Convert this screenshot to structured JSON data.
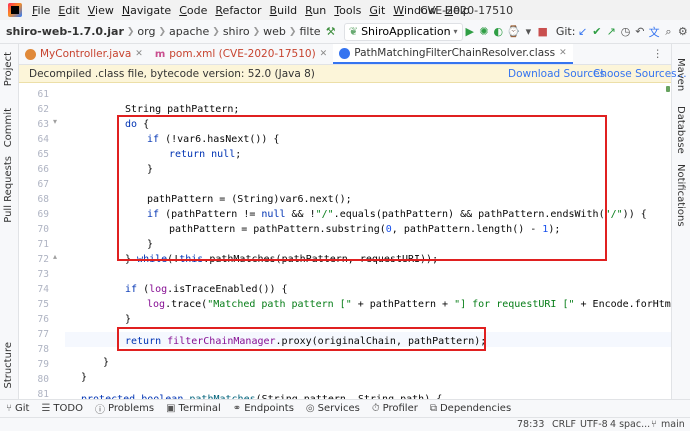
{
  "menu": [
    "File",
    "Edit",
    "View",
    "Navigate",
    "Code",
    "Refactor",
    "Build",
    "Run",
    "Tools",
    "Git",
    "Window",
    "Help"
  ],
  "window_title": "CVE-2020-17510",
  "breadcrumbs": [
    "shiro-web-1.7.0.jar",
    "org",
    "apache",
    "shiro",
    "web",
    "filte"
  ],
  "run_config": "ShiroApplication",
  "git_label": "Git:",
  "tabs": [
    {
      "label": "MyController.java",
      "color": "#e0893a"
    },
    {
      "label": "pom.xml (CVE-2020-17510)",
      "color": "#6c707e"
    },
    {
      "label": "PathMatchingFilterChainResolver.class",
      "color": "#3574f0"
    }
  ],
  "left_tools": [
    "Project",
    "Commit",
    "Pull Requests",
    "Structure"
  ],
  "right_tools": [
    "Maven",
    "Database",
    "Notifications"
  ],
  "banner": {
    "text": "Decompiled .class file, bytecode version: 52.0 (Java 8)",
    "download": "Download Sources",
    "choose": "Choose Sources..."
  },
  "line_numbers": [
    "61",
    "62",
    "63",
    "64",
    "65",
    "66",
    "67",
    "68",
    "69",
    "70",
    "71",
    "72",
    "73",
    "74",
    "75",
    "76",
    "77",
    "78",
    "79",
    "80",
    "81",
    "82"
  ],
  "bottom_tools": [
    "Git",
    "TODO",
    "Problems",
    "Terminal",
    "Endpoints",
    "Services",
    "Profiler",
    "Dependencies"
  ],
  "status": {
    "position": "78:33",
    "line_sep": "CRLF",
    "encoding": "UTF-8",
    "indent": "4 spac...",
    "branch": "main"
  }
}
